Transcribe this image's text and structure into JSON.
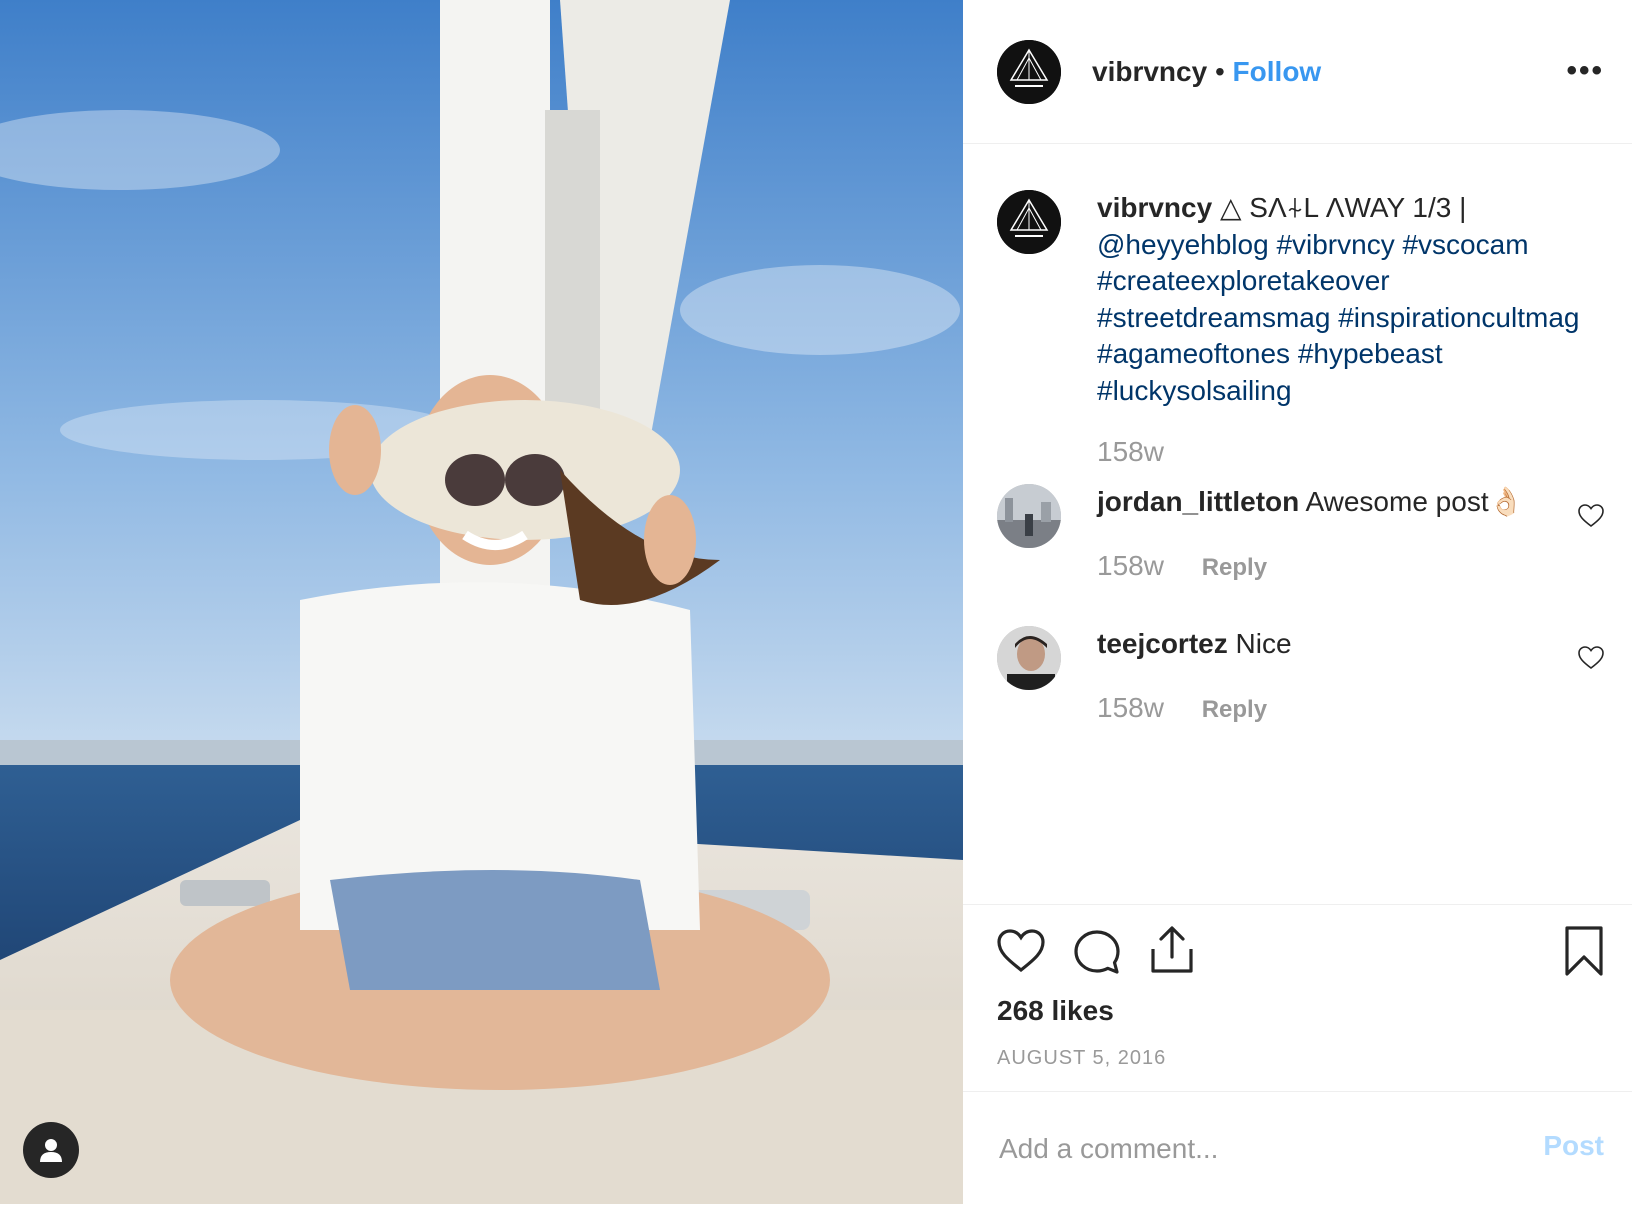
{
  "post": {
    "author": "vibrvncy",
    "separator": "•",
    "follow_label": "Follow",
    "more_label": "•••"
  },
  "caption": {
    "author": "vibrvncy",
    "text": "△ SΛ⍭L ΛWAY 1/3 |",
    "tags": [
      "@heyyehblog",
      "#vibrvncy",
      "#vscocam",
      "#createexploretakeover",
      "#streetdreamsmag",
      "#inspirationcultmag",
      "#agameoftones",
      "#hypebeast",
      "#luckysolsailing"
    ],
    "time": "158w"
  },
  "comments": [
    {
      "author": "jordan_littleton",
      "text": "Awesome post👌🏻",
      "time": "158w",
      "reply_label": "Reply"
    },
    {
      "author": "teejcortez",
      "text": "Nice",
      "time": "158w",
      "reply_label": "Reply"
    }
  ],
  "actions": {
    "likes": "268 likes",
    "date": "AUGUST 5, 2016"
  },
  "add_comment": {
    "placeholder": "Add a comment...",
    "post_label": "Post"
  },
  "colors": {
    "link": "#3897f0",
    "hashtag": "#003569",
    "muted": "#999999",
    "post_disabled": "#b3dbff"
  },
  "icons": [
    "user-tag-icon",
    "heart-icon",
    "comment-icon",
    "share-icon",
    "bookmark-icon",
    "more-options-icon",
    "small-heart-icon"
  ]
}
